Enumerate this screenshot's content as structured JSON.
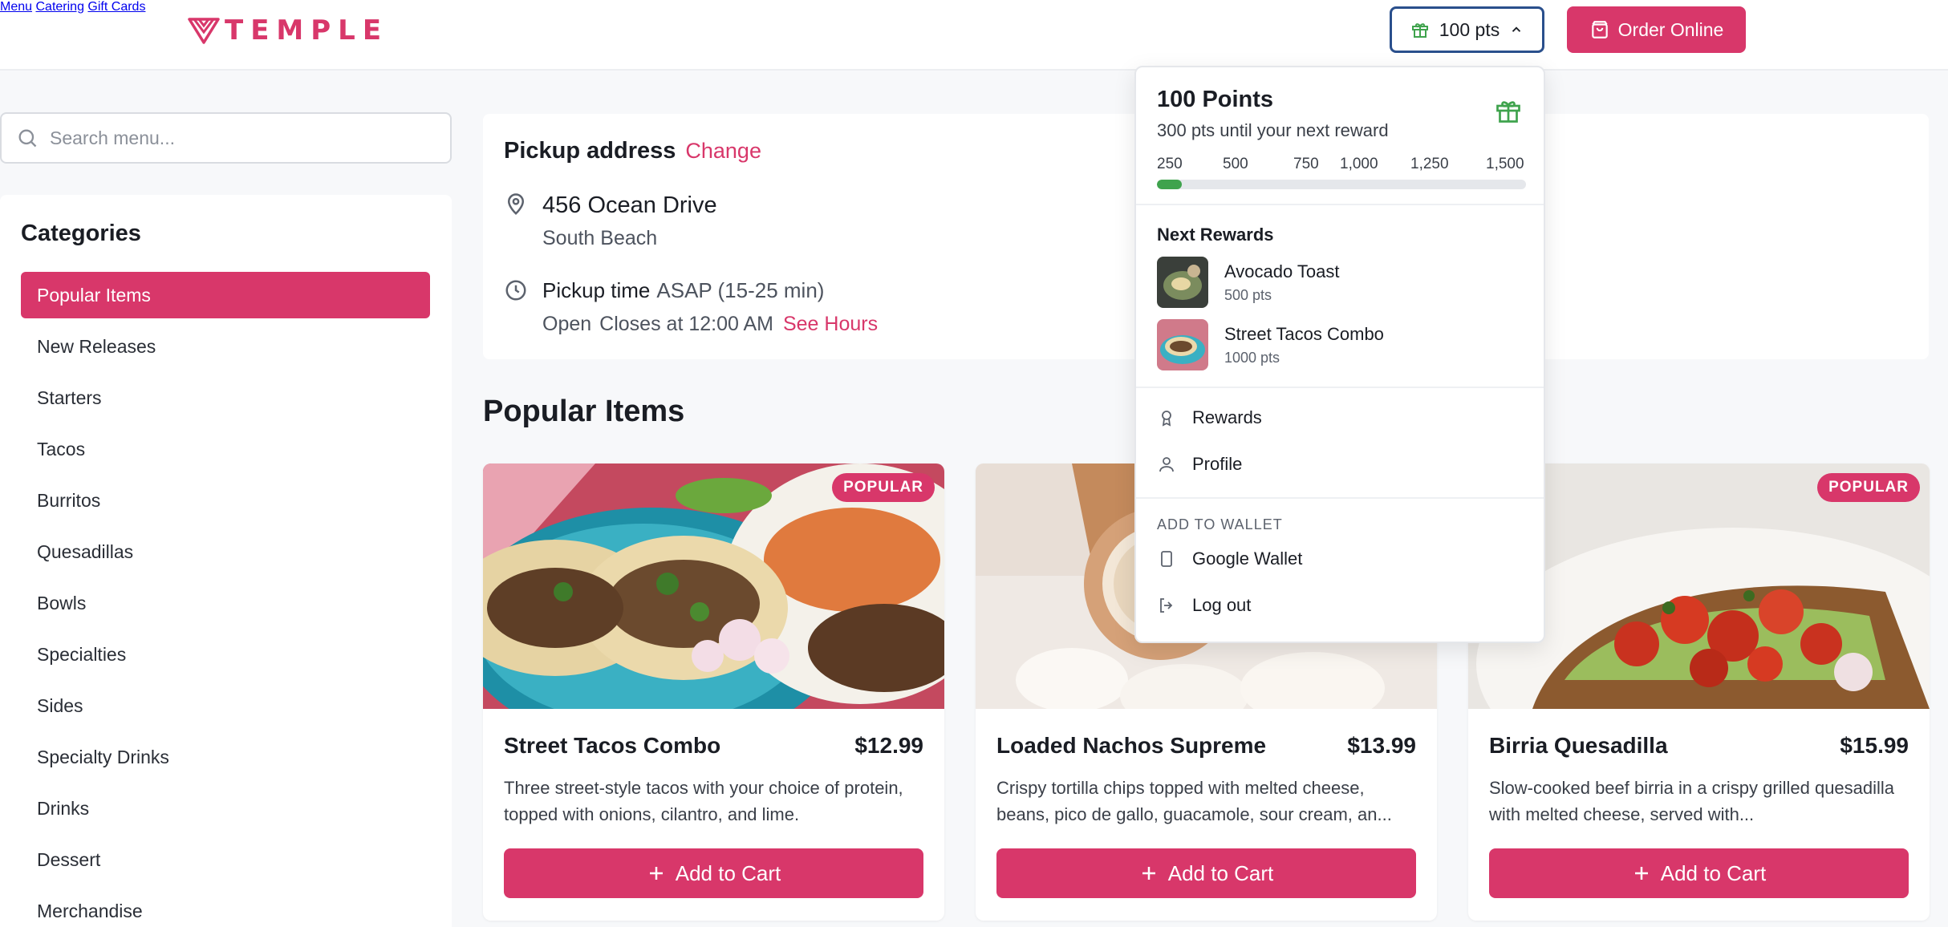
{
  "brand": {
    "name": "TEMPLE",
    "color": "#d8376a"
  },
  "nav": {
    "items": [
      "Menu",
      "Catering",
      "Gift Cards"
    ]
  },
  "header": {
    "points_label": "100 pts",
    "order_label": "Order Online"
  },
  "search": {
    "placeholder": "Search menu..."
  },
  "categories": {
    "title": "Categories",
    "items": [
      "Popular Items",
      "New Releases",
      "Starters",
      "Tacos",
      "Burritos",
      "Quesadillas",
      "Bowls",
      "Specialties",
      "Sides",
      "Specialty Drinks",
      "Drinks",
      "Dessert",
      "Merchandise"
    ],
    "active_index": 0
  },
  "pickup": {
    "title": "Pickup address",
    "change_label": "Change",
    "address_line1": "456 Ocean Drive",
    "address_line2": "South Beach",
    "time_label": "Pickup time",
    "time_value": "ASAP (15-25 min)",
    "status": "Open",
    "closes": "Closes at 12:00 AM",
    "hours_link": "See Hours"
  },
  "section": {
    "title": "Popular Items"
  },
  "products": [
    {
      "name": "Street Tacos Combo",
      "price": "$12.99",
      "desc": "Three street-style tacos with your choice of protein, topped with onions, cilantro, and lime.",
      "badge": "POPULAR",
      "cta": "Add to Cart"
    },
    {
      "name": "Loaded Nachos Supreme",
      "price": "$13.99",
      "desc": "Crispy tortilla chips topped with melted cheese, beans, pico de gallo, guacamole, sour cream, an...",
      "badge": "",
      "cta": "Add to Cart"
    },
    {
      "name": "Birria Quesadilla",
      "price": "$15.99",
      "desc": "Slow-cooked beef birria in a crispy grilled quesadilla with melted cheese, served with...",
      "badge": "POPULAR",
      "cta": "Add to Cart"
    }
  ],
  "rewards_menu": {
    "title": "100 Points",
    "subtitle": "300 pts until your next reward",
    "ticks": [
      "250",
      "500",
      "750",
      "1,000",
      "1,250",
      "1,500"
    ],
    "progress_fraction": 0.067,
    "next_title": "Next Rewards",
    "rewards": [
      {
        "name": "Avocado Toast",
        "points": "500 pts"
      },
      {
        "name": "Street Tacos Combo",
        "points": "1000 pts"
      }
    ],
    "links": [
      "Rewards",
      "Profile"
    ],
    "wallet_caption": "ADD TO WALLET",
    "wallet_items": [
      "Google Wallet",
      "Log out"
    ],
    "progress_color": "#3fa34d"
  },
  "icons": {
    "gift": "gift-icon",
    "cart": "shopping-bag-icon",
    "chevron": "chevron-up-icon",
    "search": "search-icon",
    "location": "map-pin-icon",
    "clock": "clock-icon",
    "plus": "plus-icon",
    "award": "award-icon",
    "user": "user-icon",
    "phone": "phone-icon",
    "logout": "logout-icon"
  }
}
